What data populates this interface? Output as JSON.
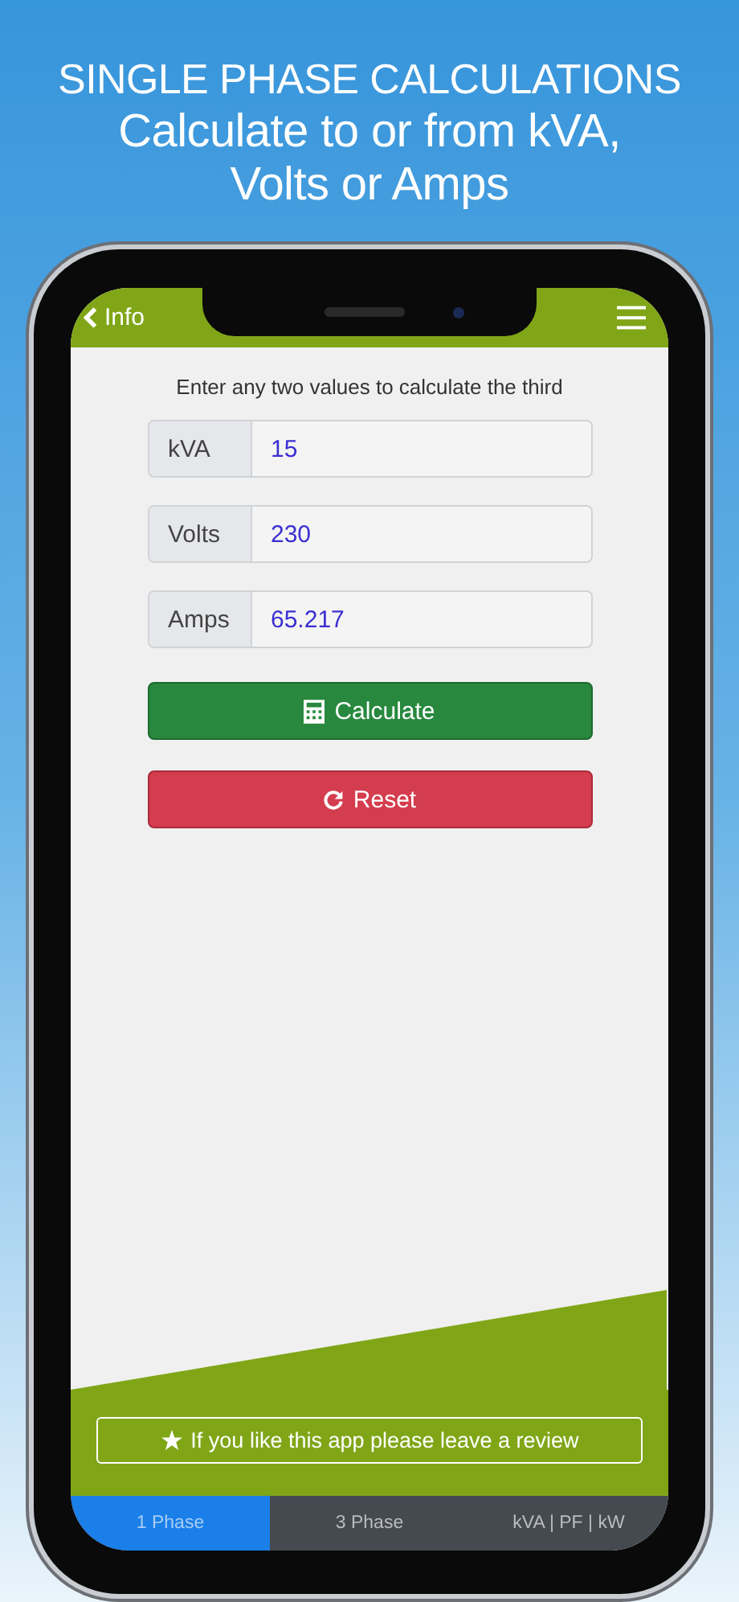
{
  "headline": [
    "SINGLE PHASE CALCULATIONS",
    "Calculate to or from kVA,",
    "Volts or Amps"
  ],
  "nav": {
    "back": "Info"
  },
  "intro": "Enter any two values to calculate the third",
  "fields": [
    {
      "label": "kVA",
      "value": "15"
    },
    {
      "label": "Volts",
      "value": "230"
    },
    {
      "label": "Amps",
      "value": "65.217"
    }
  ],
  "buttons": [
    {
      "kind": "calculate",
      "label": "Calculate"
    },
    {
      "kind": "reset",
      "label": "Reset"
    }
  ],
  "review": "If you like this app please leave a review",
  "tabs": [
    {
      "label": "1 Phase",
      "selected": true
    },
    {
      "label": "3 Phase",
      "selected": false
    },
    {
      "label": "kVA | PF | kW",
      "selected": false
    }
  ]
}
